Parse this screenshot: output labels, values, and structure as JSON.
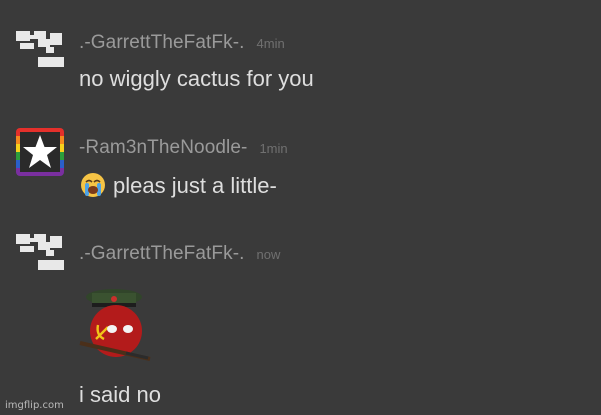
{
  "messages": [
    {
      "username": ".-GarrettTheFatFk-.",
      "timestamp": "4min",
      "text": "no wiggly cactus for you",
      "avatar_icon": "pixel-glyph-avatar"
    },
    {
      "username": "-Ram3nTheNoodle-",
      "timestamp": "1min",
      "text": "pleas just a little-",
      "avatar_icon": "rainbow-star-avatar",
      "emoji_icon": "loudly-crying-face-emoji"
    },
    {
      "username": ".-GarrettTheFatFk-.",
      "timestamp": "now",
      "text": "i said no",
      "avatar_icon": "pixel-glyph-avatar",
      "sticker_icon": "sovietball-sticker"
    }
  ],
  "watermark": "imgflip.com",
  "colors": {
    "background": "#3a3a3a",
    "username": "#9a9a9a",
    "timestamp": "#707070",
    "message_text": "#dedede"
  }
}
